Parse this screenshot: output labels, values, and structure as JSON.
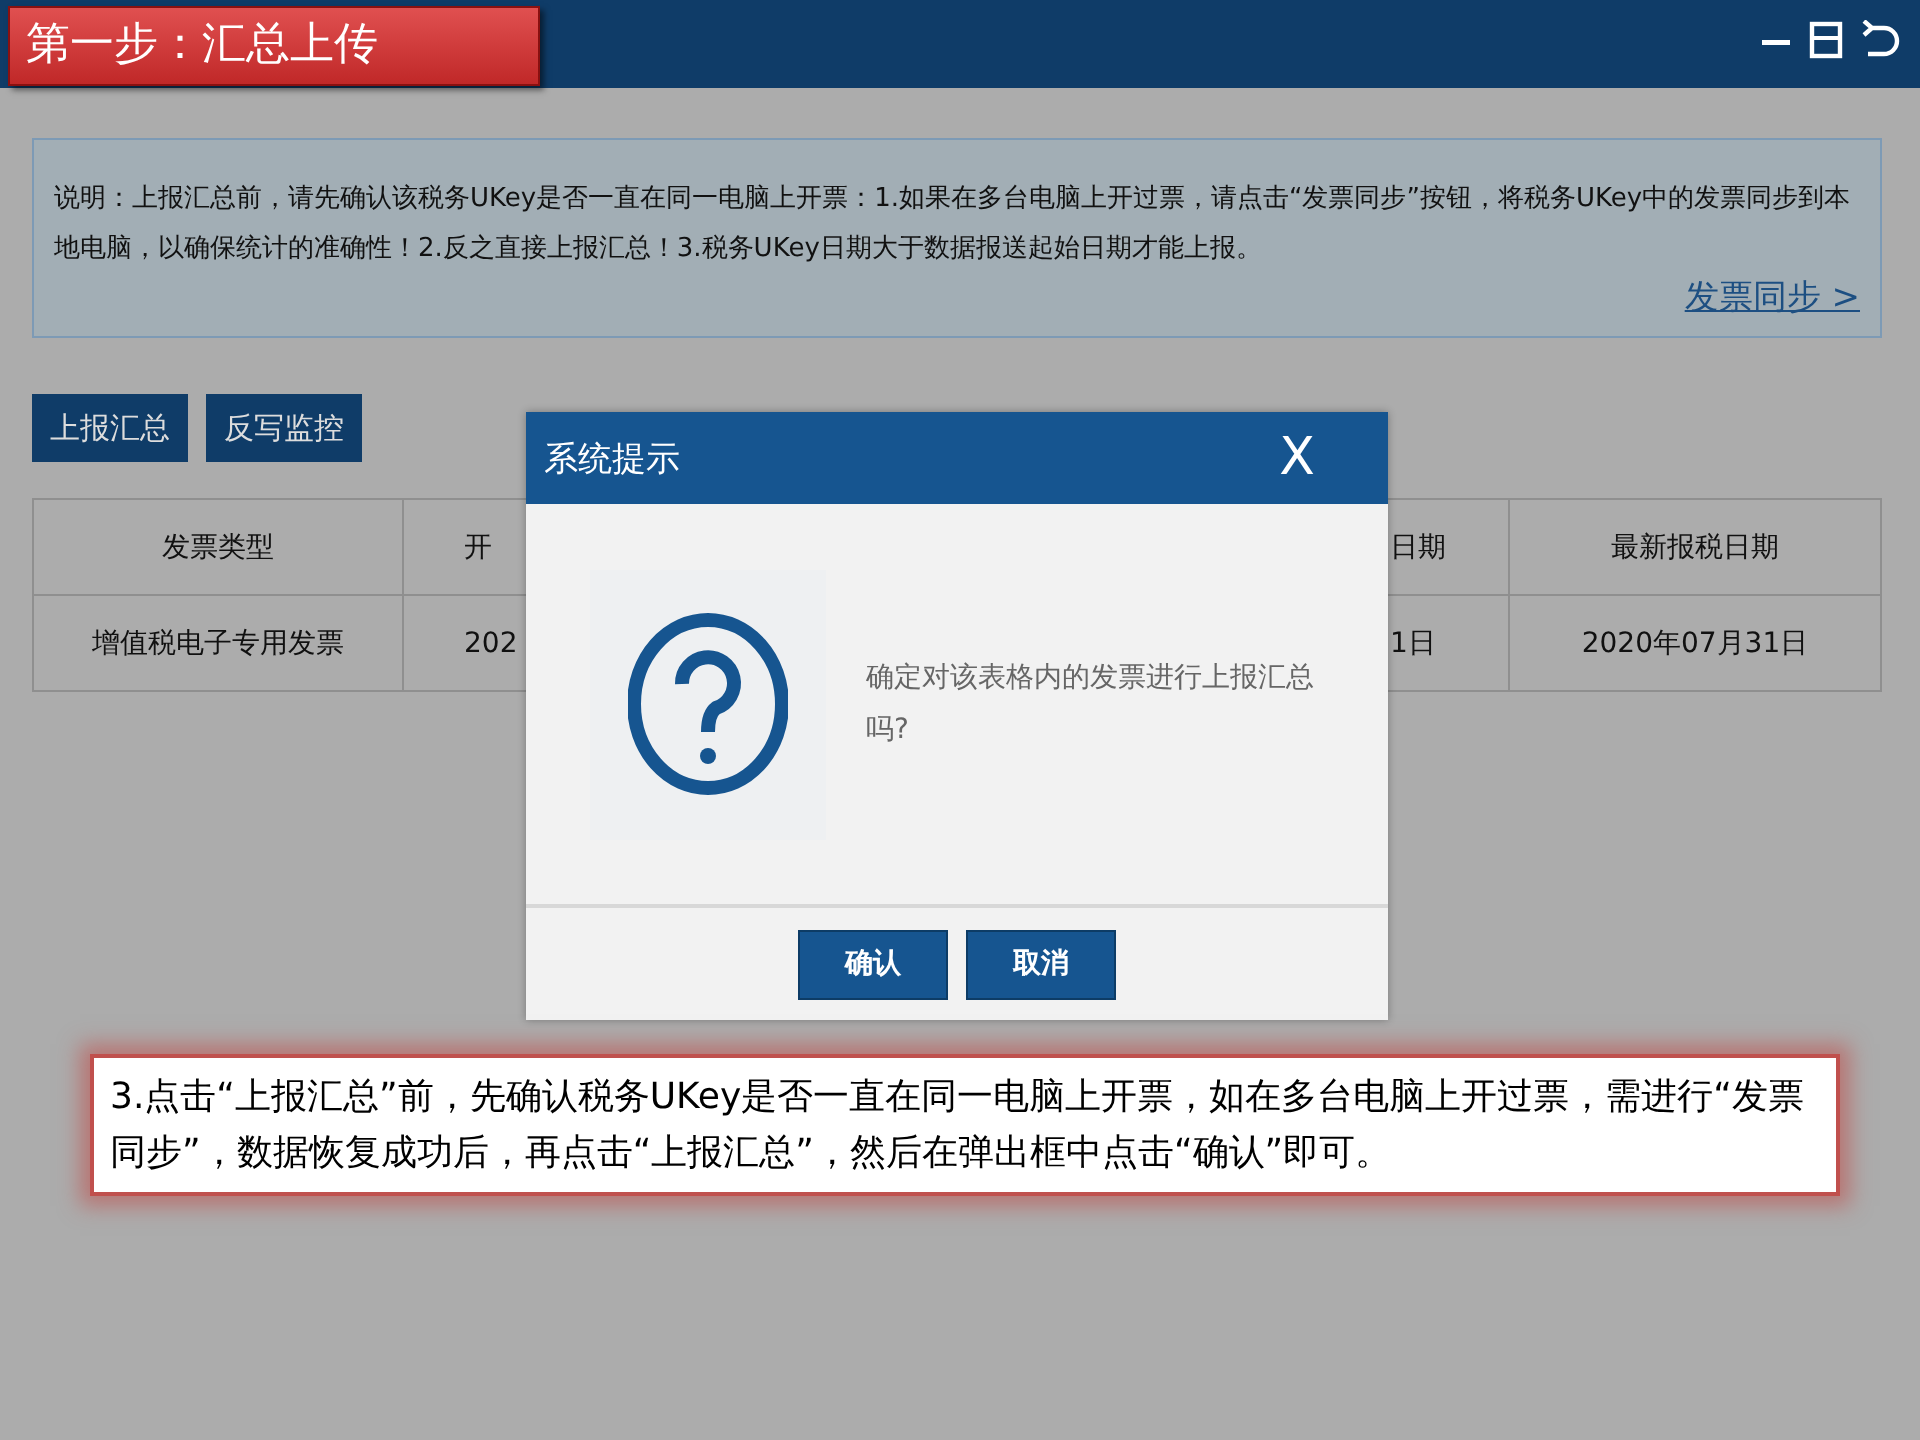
{
  "header": {
    "title": "第一步：汇总上传"
  },
  "notice": {
    "text": "说明：上报汇总前，请先确认该税务UKey是否一直在同一电脑上开票：1.如果在多台电脑上开过票，请点击“发票同步”按钮，将税务UKey中的发票同步到本地电脑，以确保统计的准确性！2.反之直接上报汇总！3.税务UKey日期大于数据报送起始日期才能上报。",
    "link": "发票同步 >"
  },
  "buttons": [
    "上报汇总",
    "反写监控"
  ],
  "table": {
    "columns": [
      "发票类型",
      "开",
      "日期",
      "最新报税日期"
    ],
    "rows": [
      [
        "增值税电子专用发票",
        "202",
        "1日",
        "2020年07月31日"
      ]
    ]
  },
  "dialog": {
    "title": "系统提示",
    "close": "X",
    "message": "确定对该表格内的发票进行上报汇总吗?",
    "buttons": [
      "确认",
      "取消"
    ]
  },
  "note": {
    "text": "3.点击“上报汇总”前，先确认税务UKey是否一直在同一电脑上开票，如在多台电脑上开过票，需进行“发票同步”，数据恢复成功后，再点击“上报汇总”，然后在弹出框中点击“确认”即可。"
  }
}
